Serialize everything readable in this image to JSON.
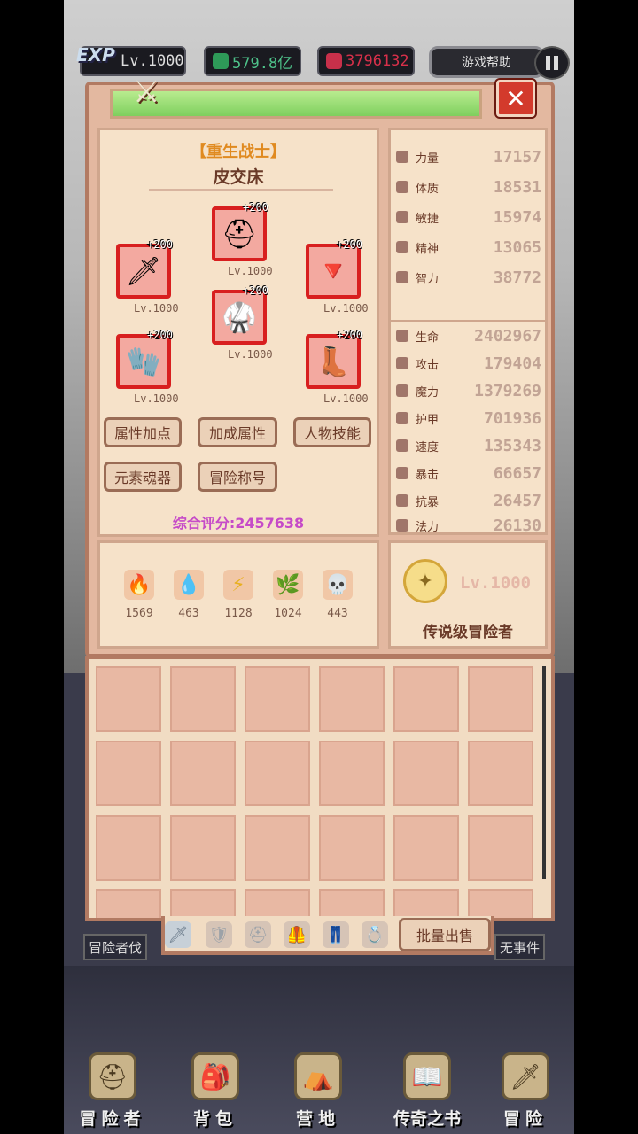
{
  "topbar": {
    "exp_tag": "EXP",
    "level": "Lv.1000",
    "green_currency": "579.8亿",
    "red_currency": "3796132",
    "help_label": "游戏帮助"
  },
  "panel": {
    "close_label": "✕",
    "char_title": "【重生战士】",
    "char_name": "皮交床",
    "equipment": [
      {
        "plus": "+200",
        "level": "Lv.1000",
        "icon": "helmet-icon",
        "glyph": "⛑"
      },
      {
        "plus": "+200",
        "level": "Lv.1000",
        "icon": "sword-icon",
        "glyph": "🗡"
      },
      {
        "plus": "+200",
        "level": "Lv.1000",
        "icon": "amulet-icon",
        "glyph": "🔻"
      },
      {
        "plus": "+200",
        "level": "Lv.1000",
        "icon": "armor-icon",
        "glyph": "🥋"
      },
      {
        "plus": "+200",
        "level": "Lv.1000",
        "icon": "gloves-icon",
        "glyph": "🧤"
      },
      {
        "plus": "+200",
        "level": "Lv.1000",
        "icon": "boots-icon",
        "glyph": "👢"
      }
    ],
    "buttons": {
      "attr_points": "属性加点",
      "bonus_attr": "加成属性",
      "char_skills": "人物技能",
      "element_soul": "元素魂器",
      "adventure_title": "冒险称号"
    },
    "score": "综合评分:2457638",
    "elements": [
      {
        "icon": "fire-icon",
        "glyph": "🔥",
        "value": "1569",
        "color": "#e85b2a"
      },
      {
        "icon": "water-icon",
        "glyph": "💧",
        "value": "463",
        "color": "#4a9be0"
      },
      {
        "icon": "lightning-icon",
        "glyph": "⚡",
        "value": "1128",
        "color": "#e8b020"
      },
      {
        "icon": "earth-icon",
        "glyph": "🌿",
        "value": "1024",
        "color": "#3ab84a"
      },
      {
        "icon": "skull-icon",
        "glyph": "💀",
        "value": "443",
        "color": "#8a7a7a"
      }
    ],
    "base_stats": [
      {
        "label": "力量",
        "value": "17157"
      },
      {
        "label": "体质",
        "value": "18531"
      },
      {
        "label": "敏捷",
        "value": "15974"
      },
      {
        "label": "精神",
        "value": "13065"
      },
      {
        "label": "智力",
        "value": "38772"
      }
    ],
    "combat_stats": [
      {
        "label": "生命",
        "value": "2402967"
      },
      {
        "label": "攻击",
        "value": "179404"
      },
      {
        "label": "魔力",
        "value": "1379269"
      },
      {
        "label": "护甲",
        "value": "701936"
      },
      {
        "label": "速度",
        "value": "135343"
      },
      {
        "label": "暴击",
        "value": "66657"
      },
      {
        "label": "抗暴",
        "value": "26457"
      },
      {
        "label": "法力",
        "value": "26130"
      }
    ],
    "rank_level": "Lv.1000",
    "rank_name": "传说级冒险者"
  },
  "inventory": {
    "bulk_sell": "批量出售",
    "left_label": "冒险者伐",
    "right_label": "无事件",
    "tabs": [
      {
        "icon": "weapon-tab-icon",
        "glyph": "🗡"
      },
      {
        "icon": "shield-tab-icon",
        "glyph": "🛡"
      },
      {
        "icon": "helmet-tab-icon",
        "glyph": "⛑"
      },
      {
        "icon": "armor-tab-icon",
        "glyph": "🦺"
      },
      {
        "icon": "pants-tab-icon",
        "glyph": "👖"
      },
      {
        "icon": "ring-tab-icon",
        "glyph": "💍"
      }
    ]
  },
  "nav": [
    {
      "label": "冒险者",
      "icon": "helmet-nav-icon",
      "glyph": "⛑"
    },
    {
      "label": "背包",
      "icon": "backpack-nav-icon",
      "glyph": "🎒"
    },
    {
      "label": "营地",
      "icon": "camp-nav-icon",
      "glyph": "⛺"
    },
    {
      "label": "传奇之书",
      "icon": "book-nav-icon",
      "glyph": "📖"
    },
    {
      "label": "冒险",
      "icon": "sword-nav-icon",
      "glyph": "🗡"
    }
  ]
}
